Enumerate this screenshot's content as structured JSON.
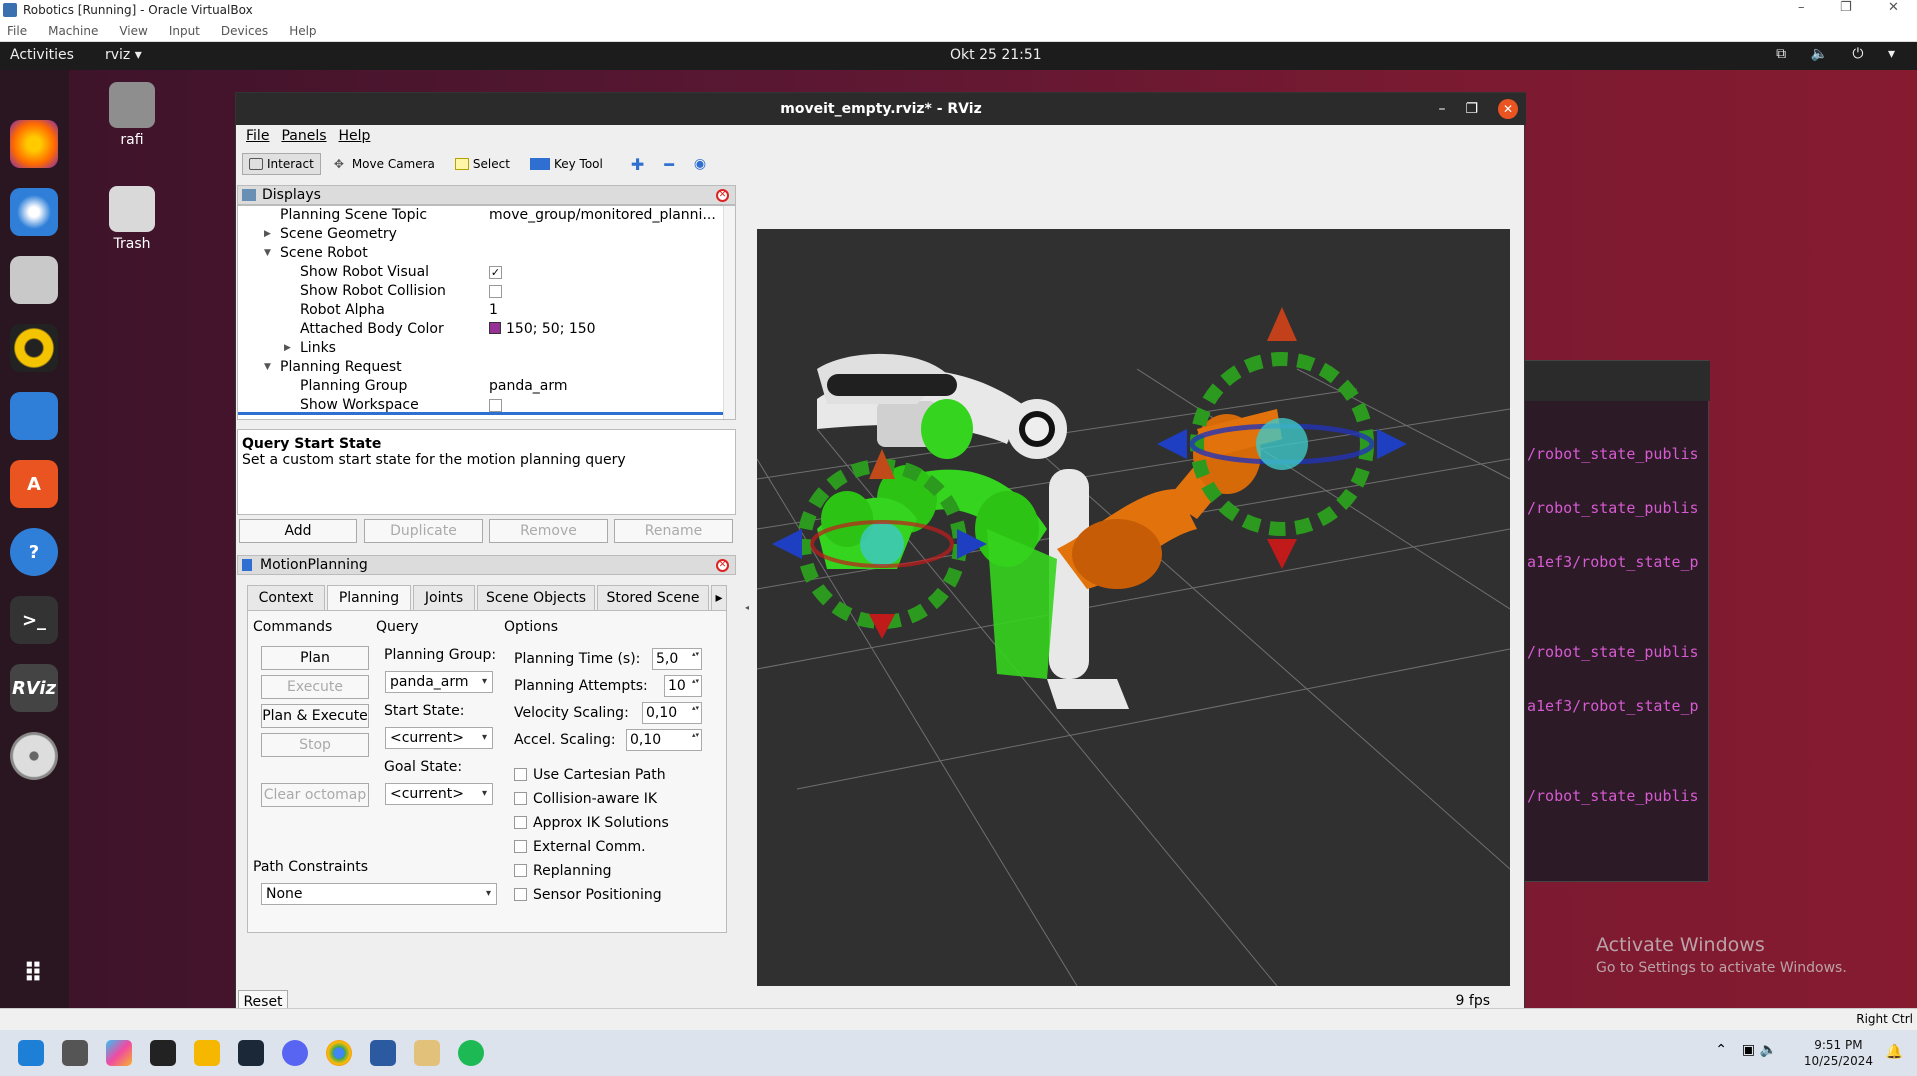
{
  "host": {
    "title": "Robotics [Running] - Oracle VirtualBox",
    "menu": [
      "File",
      "Machine",
      "View",
      "Input",
      "Devices",
      "Help"
    ],
    "status_right": "Right Ctrl",
    "window_controls": [
      "–",
      "❐",
      "✕"
    ]
  },
  "ubuntu": {
    "activities": "Activities",
    "app_name": "rviz ▾",
    "clock": "Okt 25  21:51",
    "tray": "⧉ 🔈 ⏻ ▾",
    "desktop_icons": [
      {
        "label": "rafi"
      },
      {
        "label": "Trash"
      }
    ],
    "watermark_title": "Activate Windows",
    "watermark_sub": "Go to Settings to activate Windows."
  },
  "terminal": {
    "lines": [
      "/robot_state_publis",
      "/robot_state_publis",
      "a1ef3/robot_state_p",
      "/robot_state_publis",
      "a1ef3/robot_state_p",
      "/robot_state_publis"
    ]
  },
  "rviz": {
    "title": "moveit_empty.rviz* - RViz",
    "window_controls": [
      "–",
      "❐",
      "✕"
    ],
    "menu": [
      "File",
      "Panels",
      "Help"
    ],
    "tools": [
      {
        "label": "Interact",
        "active": true
      },
      {
        "label": "Move Camera",
        "active": false
      },
      {
        "label": "Select",
        "active": false
      },
      {
        "label": "Key Tool",
        "active": false
      }
    ],
    "displays": {
      "title": "Displays",
      "rows": [
        {
          "key": "Planning Scene Topic",
          "value": "move_group/monitored_planni..."
        },
        {
          "key": "Scene Geometry",
          "value": ""
        },
        {
          "key": "Scene Robot",
          "value": ""
        },
        {
          "key": "Show Robot Visual",
          "value": "✓"
        },
        {
          "key": "Show Robot Collision",
          "value": ""
        },
        {
          "key": "Robot Alpha",
          "value": "1"
        },
        {
          "key": "Attached Body Color",
          "value": "150; 50; 150"
        },
        {
          "key": "Links",
          "value": ""
        },
        {
          "key": "Planning Request",
          "value": ""
        },
        {
          "key": "Planning Group",
          "value": "panda_arm"
        },
        {
          "key": "Show Workspace",
          "value": ""
        }
      ],
      "attached_color": "#963296",
      "desc_title": "Query Start State",
      "desc_text": "Set a custom start state for the motion planning query",
      "buttons": [
        "Add",
        "Duplicate",
        "Remove",
        "Rename"
      ]
    },
    "motion_planning": {
      "title": "MotionPlanning",
      "tabs": [
        "Context",
        "Planning",
        "Joints",
        "Scene Objects",
        "Stored Scene"
      ],
      "active_tab": "Planning",
      "commands_header": "Commands",
      "commands": [
        "Plan",
        "Execute",
        "Plan & Execute",
        "Stop",
        "Clear octomap"
      ],
      "query_header": "Query",
      "planning_group_label": "Planning Group:",
      "planning_group": "panda_arm",
      "start_state_label": "Start State:",
      "start_state": "<current>",
      "goal_state_label": "Goal State:",
      "goal_state": "<current>",
      "options_header": "Options",
      "planning_time_label": "Planning Time (s):",
      "planning_time": "5,0",
      "planning_attempts_label": "Planning Attempts:",
      "planning_attempts": "10",
      "velocity_scaling_label": "Velocity Scaling:",
      "velocity_scaling": "0,10",
      "accel_scaling_label": "Accel. Scaling:",
      "accel_scaling": "0,10",
      "checkboxes": [
        "Use Cartesian Path",
        "Collision-aware IK",
        "Approx IK Solutions",
        "External Comm.",
        "Replanning",
        "Sensor Positioning"
      ],
      "path_constraints_label": "Path Constraints",
      "path_constraints": "None"
    },
    "reset": "Reset",
    "fps": "9 fps"
  },
  "taskbar": {
    "time": "9:51 PM",
    "date": "10/25/2024"
  }
}
